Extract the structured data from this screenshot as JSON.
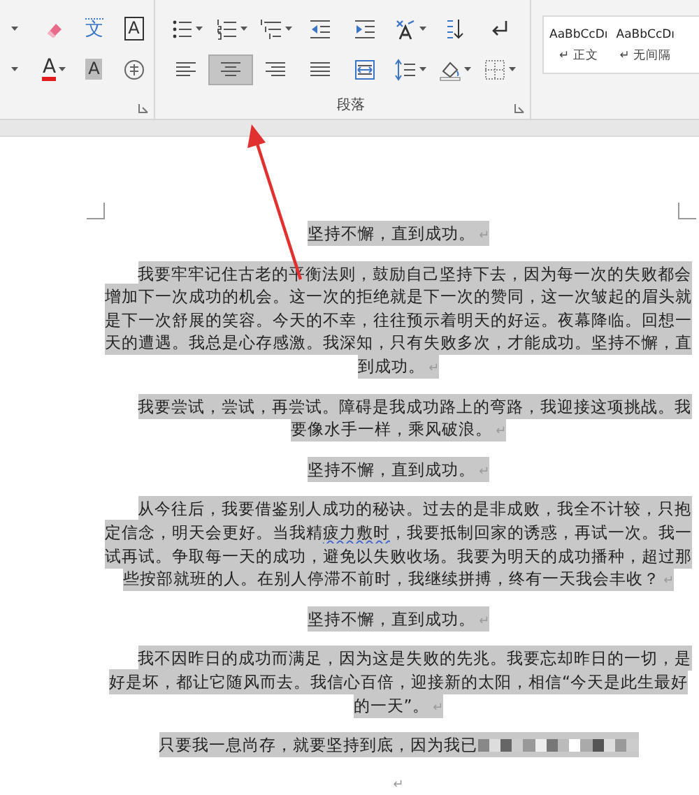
{
  "ribbon": {
    "font_group": {
      "row1": [
        {
          "kind": "dropdown",
          "dropdown": true
        },
        {
          "kind": "eraser",
          "dropdown": false
        },
        {
          "kind": "phonetic",
          "glyph": "文",
          "dropdown": false
        },
        {
          "kind": "char-border",
          "glyph": "A",
          "dropdown": false
        }
      ],
      "row2": [
        {
          "kind": "dropdown",
          "dropdown": true
        },
        {
          "kind": "font-color",
          "glyph": "A",
          "dropdown": true
        },
        {
          "kind": "char-shading",
          "glyph": "A",
          "dropdown": false
        },
        {
          "kind": "enclose",
          "dropdown": false
        }
      ]
    },
    "paragraph_group": {
      "label": "段落",
      "row1": [
        {
          "kind": "bullets",
          "dropdown": true
        },
        {
          "kind": "numbering",
          "dropdown": true
        },
        {
          "kind": "multilevel",
          "dropdown": true
        },
        {
          "kind": "outdent",
          "dropdown": false
        },
        {
          "kind": "indent",
          "dropdown": false
        },
        {
          "kind": "asian-layout",
          "dropdown": true
        },
        {
          "kind": "sort",
          "dropdown": false
        },
        {
          "kind": "show-marks",
          "dropdown": false
        }
      ],
      "row2": [
        {
          "kind": "align-left",
          "dropdown": false,
          "selected": false
        },
        {
          "kind": "align-center",
          "dropdown": false,
          "selected": true
        },
        {
          "kind": "align-right",
          "dropdown": false,
          "selected": false
        },
        {
          "kind": "justify",
          "dropdown": false,
          "selected": false
        },
        {
          "kind": "distribute",
          "dropdown": false,
          "selected": false
        },
        {
          "kind": "line-spacing",
          "dropdown": true,
          "selected": false
        },
        {
          "kind": "shading",
          "dropdown": true,
          "selected": false
        },
        {
          "kind": "borders",
          "dropdown": true,
          "selected": false
        }
      ]
    },
    "styles": [
      {
        "preview": "AaBbCcDı",
        "label": "↵ 正文"
      },
      {
        "preview": "AaBbCcDı",
        "label": "↵ 无间隔"
      }
    ]
  },
  "document": {
    "paragraphs": [
      {
        "kind": "title",
        "segments": [
          {
            "text": "坚持不懈，直到成功。",
            "spelling_error": false
          }
        ],
        "end_mark": "↵",
        "redacted": false
      },
      {
        "kind": "body",
        "segments": [
          {
            "text": "我要牢牢记住古老的平衡法则，鼓励自己坚持下去，因为每一次的失败都会增加下一次成功的机会。这一次的拒绝就是下一次的赞同，这一次皱起的眉头就是下一次舒展的笑容。今天的不幸，往往预示着明天的好运。夜幕降临。回想一天的遭遇。我总是心存感激。我深知，只有失败多次，才能成功。坚持不懈，直到成功。",
            "spelling_error": false
          }
        ],
        "end_mark": "↵",
        "redacted": false
      },
      {
        "kind": "body",
        "segments": [
          {
            "text": "我要尝试，尝试，再尝试。障碍是我成功路上的弯路，我迎接这项挑战。我要像水手一样，乘风破浪。",
            "spelling_error": false
          }
        ],
        "end_mark": "↵",
        "redacted": false
      },
      {
        "kind": "title",
        "segments": [
          {
            "text": "坚持不懈，直到成功。",
            "spelling_error": false
          }
        ],
        "end_mark": "↵",
        "redacted": false
      },
      {
        "kind": "body",
        "segments": [
          {
            "text": "从今往后，我要借鉴别人成功的秘诀。过去的是非成败，我全不计较，只抱定信念，明天会更好。当我精",
            "spelling_error": false
          },
          {
            "text": "疲力敷时",
            "spelling_error": true
          },
          {
            "text": "，我要抵制回家的诱惑，再试一次。我一试再试。争取每一天的成功，避免以失败收场。我要为明天的成功播种，超过那些按部就班的人。在别人停滞不前时，我继续拼搏，终有一天我会丰收？",
            "spelling_error": false
          }
        ],
        "end_mark": "↵",
        "redacted": false
      },
      {
        "kind": "title",
        "segments": [
          {
            "text": "坚持不懈，直到成功。",
            "spelling_error": false
          }
        ],
        "end_mark": "↵",
        "redacted": false
      },
      {
        "kind": "body",
        "segments": [
          {
            "text": "我不因昨日的成功而满足，因为这是失败的先兆。我要忘却昨日的一切，是好是坏，都让它随风而去。我信心百倍，迎接新的太阳，相信“今天是此生最好的一天”。",
            "spelling_error": false
          }
        ],
        "end_mark": "↵",
        "redacted": false
      },
      {
        "kind": "title",
        "segments": [
          {
            "text": "只要我一息尚存，就要坚持到底，因为我已",
            "spelling_error": false
          }
        ],
        "redacted": true
      },
      {
        "kind": "empty",
        "end_mark": "↵"
      }
    ]
  }
}
